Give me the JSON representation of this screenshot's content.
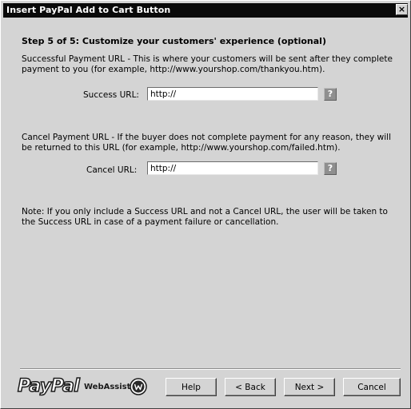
{
  "window": {
    "title": "Insert PayPal Add to Cart Button",
    "close_label": "×"
  },
  "step": {
    "title": "Step 5 of 5: Customize your customers' experience (optional)"
  },
  "success": {
    "description": "Successful Payment URL - This is where your customers will be sent after they complete payment to you (for example, http://www.yourshop.com/thankyou.htm).",
    "label": "Success URL:",
    "value": "http://",
    "help_icon": "?"
  },
  "cancel": {
    "description": "Cancel Payment URL - If the buyer does not complete payment for any reason, they will be returned to this URL (for example, http://www.yourshop.com/failed.htm).",
    "label": "Cancel URL:",
    "value": "http://",
    "help_icon": "?"
  },
  "note": {
    "text": "Note: If you only include a Success URL and not a Cancel URL, the user will be taken to the Success URL in case of a payment failure or cancellation."
  },
  "footer": {
    "paypal_logo": "PayPal",
    "webassist_text": "WebAssist",
    "buttons": {
      "help": "Help",
      "back": "< Back",
      "next": "Next >",
      "cancel": "Cancel"
    }
  },
  "colors": {
    "titlebar": "#0a0a0a",
    "window_bg": "#d4d4d4",
    "help_icon_bg": "#8f8f8f"
  }
}
